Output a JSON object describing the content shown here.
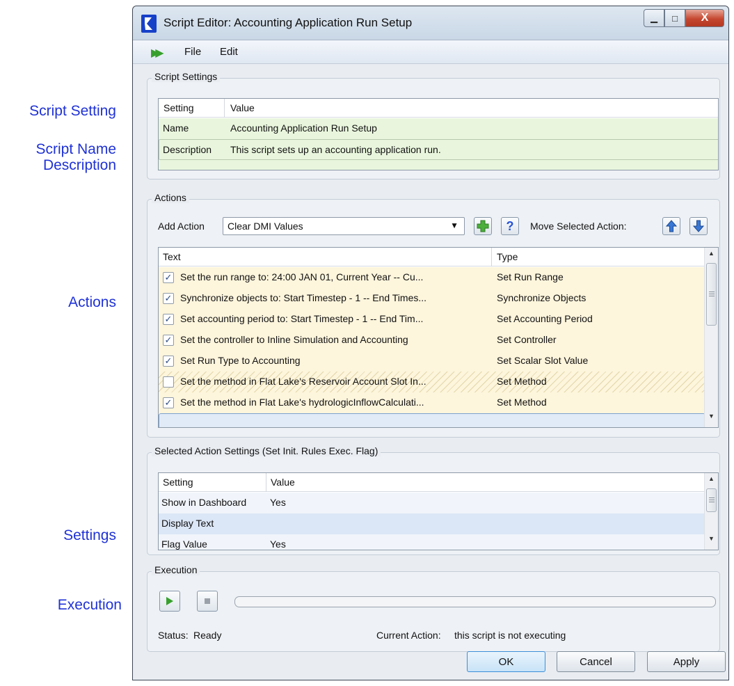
{
  "annotations": {
    "script_setting": "Script Setting",
    "script_name": "Script Name",
    "description": "Description",
    "actions": "Actions",
    "settings": "Settings",
    "execution": "Execution"
  },
  "window": {
    "title": "Script Editor: Accounting Application Run Setup",
    "controls": {
      "minimize": "▁",
      "maximize": "□",
      "close": "X"
    }
  },
  "menu": {
    "run_icon": "run-script-icon",
    "file": "File",
    "edit": "Edit"
  },
  "script_settings": {
    "group_title": "Script Settings",
    "columns": [
      "Setting",
      "Value"
    ],
    "rows": [
      {
        "setting": "Name",
        "value": "Accounting Application Run Setup"
      },
      {
        "setting": "Description",
        "value": "This script sets up an accounting application run."
      }
    ]
  },
  "actions": {
    "group_title": "Actions",
    "add_action_label": "Add Action",
    "add_action_selected": "Clear DMI Values",
    "move_label": "Move Selected Action:",
    "help_label": "?",
    "columns": [
      "Text",
      "Type"
    ],
    "rows": [
      {
        "checked": true,
        "text": "Set the run range to: 24:00 JAN 01, Current Year -- Cu...",
        "type": "Set Run Range"
      },
      {
        "checked": true,
        "text": "Synchronize objects to: Start Timestep - 1 -- End Times...",
        "type": "Synchronize Objects"
      },
      {
        "checked": true,
        "text": "Set accounting period to: Start Timestep - 1 -- End Tim...",
        "type": "Set Accounting Period"
      },
      {
        "checked": true,
        "text": "Set the controller to Inline Simulation and Accounting",
        "type": "Set Controller"
      },
      {
        "checked": true,
        "text": "Set Run Type to Accounting",
        "type": "Set Scalar Slot Value"
      },
      {
        "checked": false,
        "text": "Set the method in Flat Lake's Reservoir Account Slot In...",
        "type": "Set Method"
      },
      {
        "checked": true,
        "text": "Set the method in Flat Lake's hydrologicInflowCalculati...",
        "type": "Set Method"
      }
    ]
  },
  "selected_action": {
    "group_title": "Selected Action Settings (Set Init. Rules Exec. Flag)",
    "columns": [
      "Setting",
      "Value"
    ],
    "rows": [
      {
        "setting": "Show in Dashboard",
        "value": "Yes"
      },
      {
        "setting": "Display Text",
        "value": ""
      },
      {
        "setting": "Flag Value",
        "value": "Yes"
      }
    ]
  },
  "execution": {
    "group_title": "Execution",
    "status_label": "Status:",
    "status_value": "Ready",
    "current_action_label": "Current Action:",
    "current_action_value": "this script is not executing"
  },
  "buttons": {
    "ok": "OK",
    "cancel": "Cancel",
    "apply": "Apply"
  },
  "colors": {
    "accent": "#1f32d6",
    "settings_row": "#e9f6dd",
    "action_row": "#fdf5dc",
    "selected_row": "#e1eaf7",
    "run_green": "#37a02d"
  }
}
